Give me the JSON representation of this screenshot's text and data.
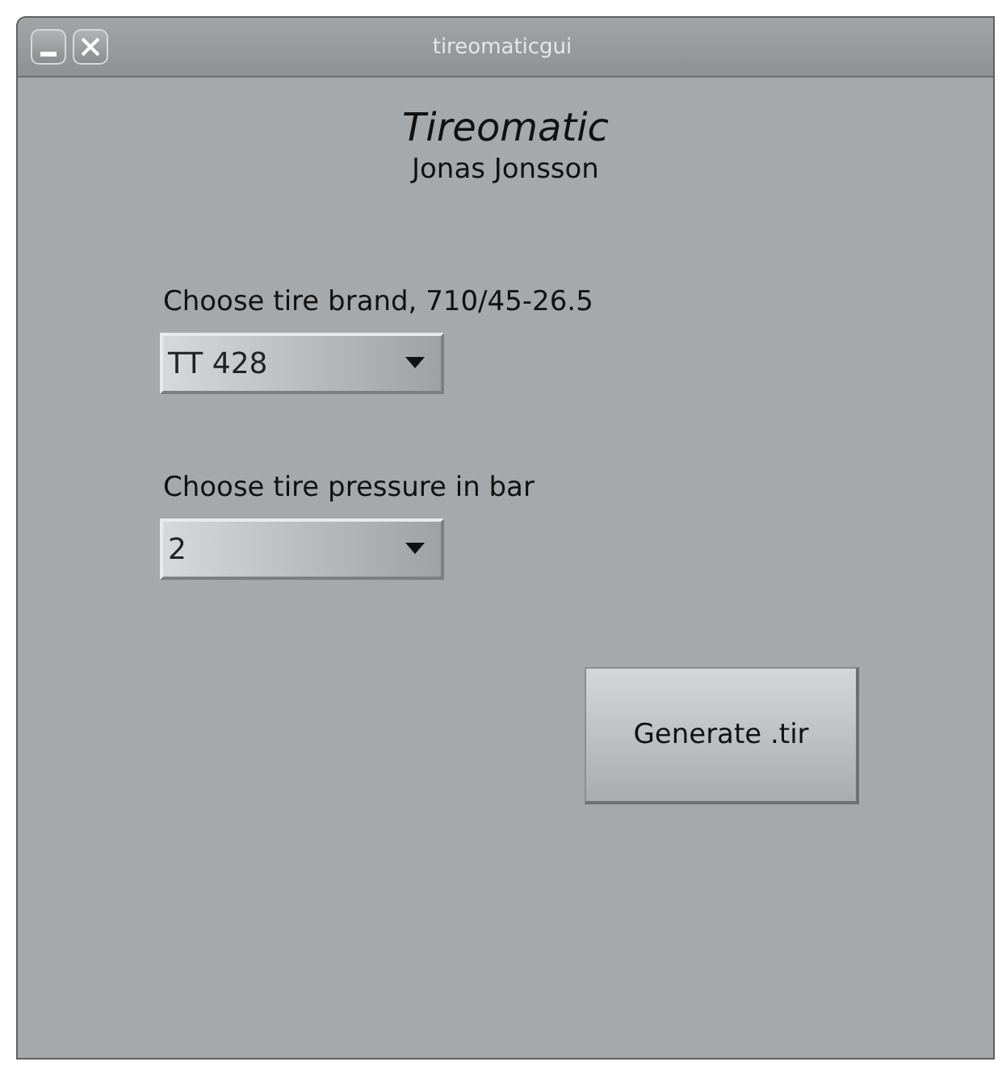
{
  "window": {
    "title": "tireomaticgui"
  },
  "app_title": "Tireomatic",
  "author": "Jonas Jonsson",
  "fields": [
    {
      "label": "Choose tire brand, 710/45-26.5",
      "value": "TT 428"
    },
    {
      "label": "Choose tire pressure in bar",
      "value": "2"
    }
  ],
  "button": "Generate .tir"
}
